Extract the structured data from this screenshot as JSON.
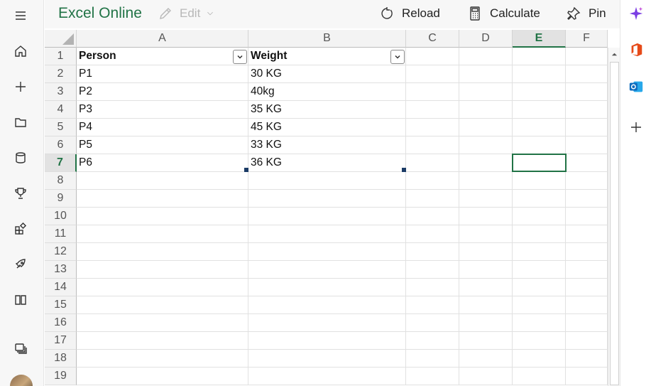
{
  "app": {
    "title": "Excel Online"
  },
  "toolbar": {
    "edit_label": "Edit",
    "reload_label": "Reload",
    "calculate_label": "Calculate",
    "pin_label": "Pin"
  },
  "left_rail": {
    "icons": [
      "menu-icon",
      "home-icon",
      "plus-icon",
      "folder-icon",
      "database-icon",
      "trophy-icon",
      "apps-icon",
      "rocket-icon",
      "book-icon",
      "windows-icon",
      "avatar"
    ]
  },
  "right_rail": {
    "icons": [
      "copilot-icon",
      "office-icon",
      "outlook-icon",
      "plus-icon"
    ]
  },
  "sheet": {
    "columns": [
      "A",
      "B",
      "C",
      "D",
      "E",
      "F"
    ],
    "rows": [
      "1",
      "2",
      "3",
      "4",
      "5",
      "6",
      "7",
      "8",
      "9",
      "10",
      "11",
      "12",
      "13",
      "14",
      "15",
      "16",
      "17",
      "18",
      "19"
    ],
    "active_column": "E",
    "active_row": "7",
    "cells": [
      [
        "Person",
        "Weight"
      ],
      [
        "P1",
        "30 KG"
      ],
      [
        "P2",
        "40kg"
      ],
      [
        "P3",
        "35 KG"
      ],
      [
        "P4",
        "45 KG"
      ],
      [
        "P5",
        "33 KG"
      ],
      [
        "P6",
        "36 KG"
      ]
    ]
  },
  "colors": {
    "accent": "#217346",
    "copilot": "#7b3fe4",
    "office": "#e64a19",
    "outlook": "#0f6cbd"
  }
}
